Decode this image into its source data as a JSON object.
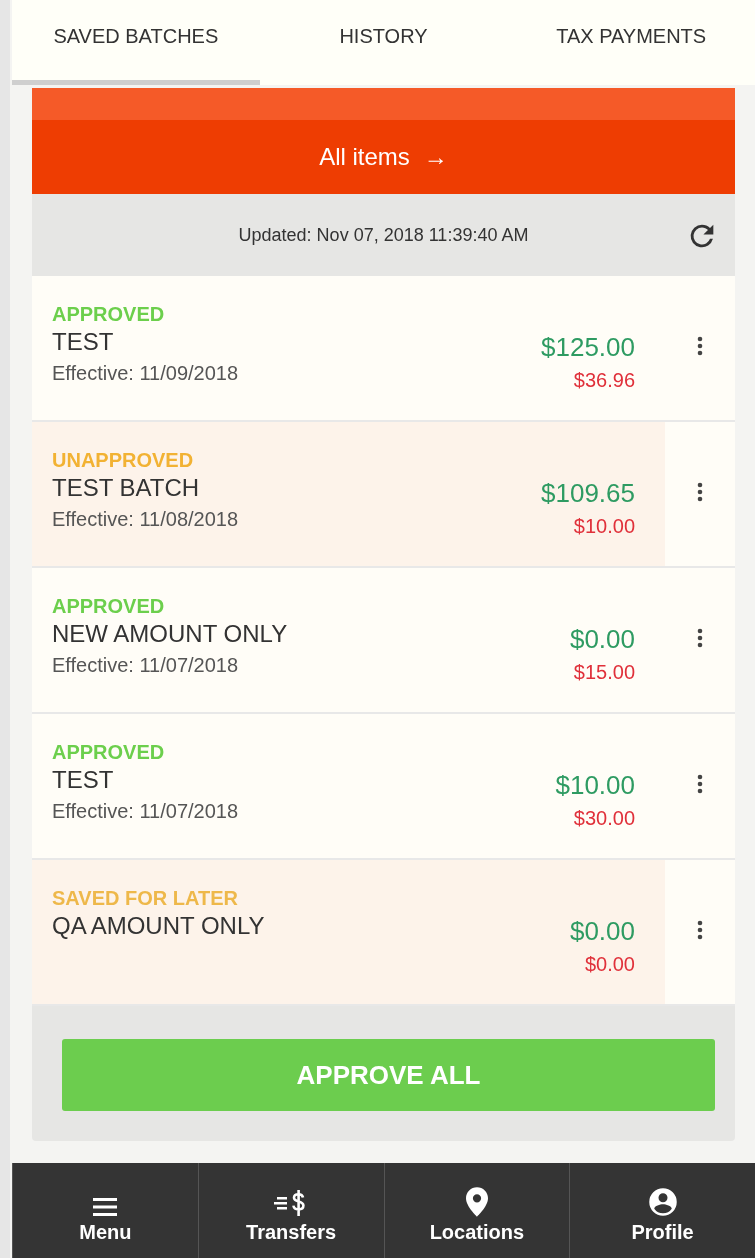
{
  "tabs": [
    {
      "label": "SAVED BATCHES",
      "selected": true
    },
    {
      "label": "HISTORY",
      "selected": false
    },
    {
      "label": "TAX PAYMENTS",
      "selected": false
    }
  ],
  "banner": {
    "label": "All items",
    "arrow": "→"
  },
  "updated": {
    "text": "Updated: Nov 07, 2018 11:39:40 AM"
  },
  "batches": [
    {
      "status": "APPROVED",
      "color": "#6ccf4c",
      "name": "TEST",
      "effective": "Effective: 11/09/2018",
      "amount": "$125.00",
      "fee": "$36.96",
      "highlighted": false
    },
    {
      "status": "UNAPPROVED",
      "color": "#f2b233",
      "name": "TEST BATCH",
      "effective": "Effective: 11/08/2018",
      "amount": "$109.65",
      "fee": "$10.00",
      "highlighted": true
    },
    {
      "status": "APPROVED",
      "color": "#6ccf4c",
      "name": "NEW AMOUNT ONLY",
      "effective": "Effective: 11/07/2018",
      "amount": "$0.00",
      "fee": "$15.00",
      "highlighted": false
    },
    {
      "status": "APPROVED",
      "color": "#6ccf4c",
      "name": "TEST",
      "effective": "Effective: 11/07/2018",
      "amount": "$10.00",
      "fee": "$30.00",
      "highlighted": false
    },
    {
      "status": "SAVED FOR LATER",
      "color": "#eeb84a",
      "name": "QA AMOUNT ONLY",
      "amount": "$0.00",
      "fee": "$0.00",
      "highlighted": true
    }
  ],
  "approve_button": {
    "label": "APPROVE ALL"
  },
  "nav": [
    {
      "kind": "menu",
      "label": "Menu"
    },
    {
      "kind": "transfers",
      "label": "Transfers"
    },
    {
      "kind": "locations",
      "label": "Locations"
    },
    {
      "kind": "profile",
      "label": "Profile"
    }
  ]
}
